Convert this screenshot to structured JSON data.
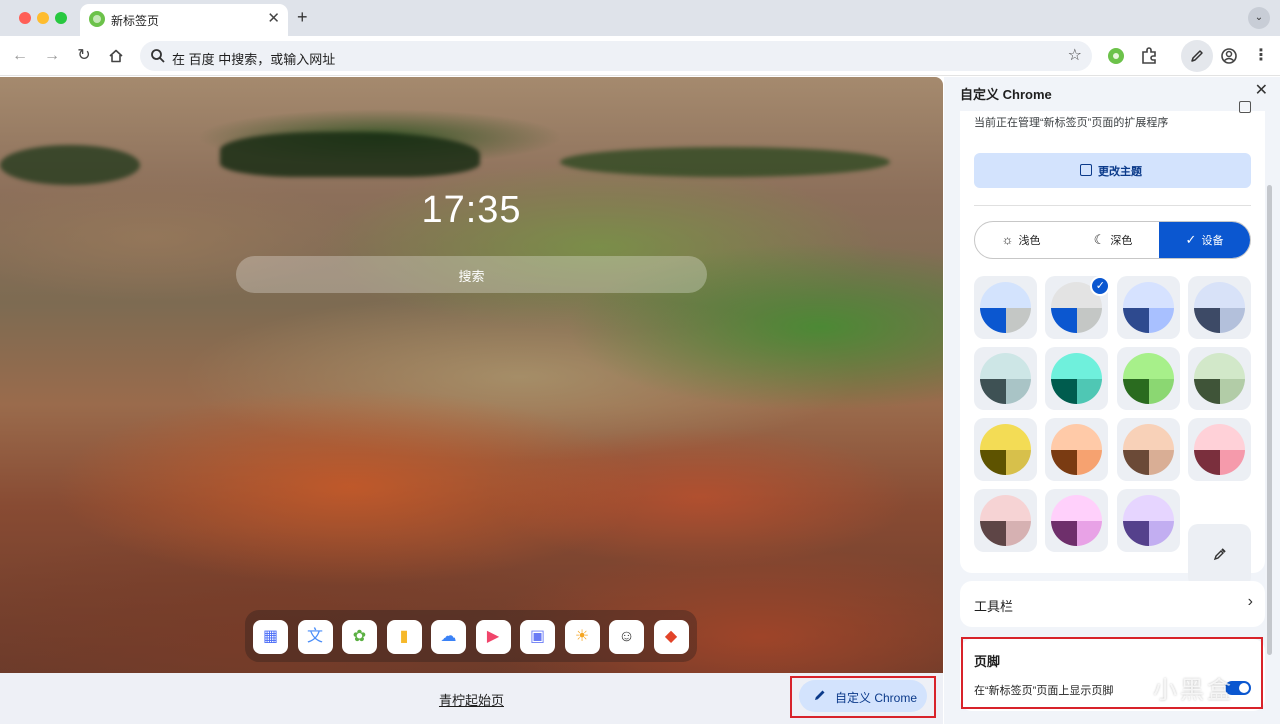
{
  "browser": {
    "tab_title": "新标签页",
    "tab_close": "✕",
    "new_tab": "+",
    "omnibox_text": "在 百度 中搜索，或输入网址"
  },
  "ntp": {
    "clock": "17:35",
    "search_placeholder": "搜索",
    "footer_link": "青柠起始页",
    "customize_label": "自定义 Chrome",
    "dock_apps": [
      {
        "icon": "apps-grid-icon",
        "glyph": "▦",
        "color": "#4a6cf7"
      },
      {
        "icon": "translate-icon",
        "glyph": "文",
        "color": "#4a8df8"
      },
      {
        "icon": "openai-icon",
        "glyph": "✿",
        "color": "#5bb043"
      },
      {
        "icon": "notes-icon",
        "glyph": "▮",
        "color": "#f6b82a"
      },
      {
        "icon": "cloud-icon",
        "glyph": "☁",
        "color": "#3b82f6"
      },
      {
        "icon": "video-icon",
        "glyph": "▶",
        "color": "#f0456b"
      },
      {
        "icon": "photos-icon",
        "glyph": "▣",
        "color": "#6a7cf5"
      },
      {
        "icon": "weather-icon",
        "glyph": "☀",
        "color": "#f5a623"
      },
      {
        "icon": "avatar-icon",
        "glyph": "☺",
        "color": "#333333"
      },
      {
        "icon": "gitlab-icon",
        "glyph": "◆",
        "color": "#e24329"
      }
    ]
  },
  "panel": {
    "title": "自定义 Chrome",
    "close": "✕",
    "managed_text": "当前正在管理“新标签页”页面的扩展程序",
    "change_theme": "更改主题",
    "modes": [
      {
        "label": "浅色",
        "glyph": "☼",
        "selected": false
      },
      {
        "label": "深色",
        "glyph": "☾",
        "selected": false
      },
      {
        "label": "设备",
        "glyph": "✓",
        "selected": true
      }
    ],
    "swatches": [
      {
        "top": "#d3e3fd",
        "bl": "#0b57d0",
        "br": "#c4c7c5",
        "selected": false
      },
      {
        "top": "#e3e3e3",
        "bl": "#0b57d0",
        "br": "#c4c7c5",
        "selected": true
      },
      {
        "top": "#d6e2ff",
        "bl": "#2e4a8f",
        "br": "#a8c0ff",
        "selected": false
      },
      {
        "top": "#d8e2f8",
        "bl": "#3d4a66",
        "br": "#b3c0db",
        "selected": false
      },
      {
        "top": "#cde6e6",
        "bl": "#3e5154",
        "br": "#a9c4c6",
        "selected": false
      },
      {
        "top": "#6ff0dc",
        "bl": "#005c4e",
        "br": "#4fc7b4",
        "selected": false
      },
      {
        "top": "#a7f08a",
        "bl": "#2a6b1f",
        "br": "#8bd772",
        "selected": false
      },
      {
        "top": "#d2e8c9",
        "bl": "#3f5438",
        "br": "#b2cca7",
        "selected": false
      },
      {
        "top": "#f3dc55",
        "bl": "#5e5300",
        "br": "#d7c04b",
        "selected": false
      },
      {
        "top": "#ffcaa8",
        "bl": "#7a3b12",
        "br": "#f6a270",
        "selected": false
      },
      {
        "top": "#f8d1b8",
        "bl": "#6b4a37",
        "br": "#d9ae95",
        "selected": false
      },
      {
        "top": "#ffd1d8",
        "bl": "#7a2f3d",
        "br": "#f59aab",
        "selected": false
      },
      {
        "top": "#f6d3d4",
        "bl": "#5e4546",
        "br": "#d6b1b2",
        "selected": false
      },
      {
        "top": "#ffd0fb",
        "bl": "#6e2f6b",
        "br": "#e8a2e6",
        "selected": false
      },
      {
        "top": "#e6d5ff",
        "bl": "#55418c",
        "br": "#c2aef1",
        "selected": false
      }
    ],
    "toolbar_label": "工具栏",
    "footer_title": "页脚",
    "footer_desc": "在“新标签页”页面上显示页脚",
    "footer_enabled": true
  },
  "watermark": "小黑盒"
}
